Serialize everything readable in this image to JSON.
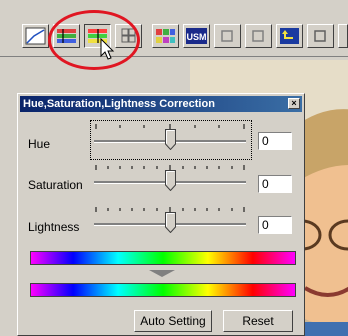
{
  "dialog": {
    "title": "Hue,Saturation,Lightness Correction",
    "close_symbol": "×"
  },
  "controls": [
    {
      "label": "Hue",
      "value": "0",
      "level_percent": 50
    },
    {
      "label": "Saturation",
      "value": "0",
      "level_percent": 50
    },
    {
      "label": "Lightness",
      "value": "0",
      "level_percent": 50
    }
  ],
  "buttons": {
    "auto_setting": "Auto Setting",
    "reset": "Reset"
  },
  "toolbar": {
    "icons": [
      "tone-curve-icon",
      "color-balance-icon",
      "hue-saturation-lightness-icon",
      "selective-color-icon",
      "variations-icon",
      "unsharp-mask-icon",
      "snapshot-icon",
      "compare-icon",
      "undo-icon",
      "more-icon"
    ],
    "usm_label": "USM"
  },
  "colors": {
    "highlight_ring": "#e01622",
    "title_bar_start": "#0a246a",
    "title_bar_end": "#3a6ea5",
    "window_face": "#d4d0c8"
  }
}
